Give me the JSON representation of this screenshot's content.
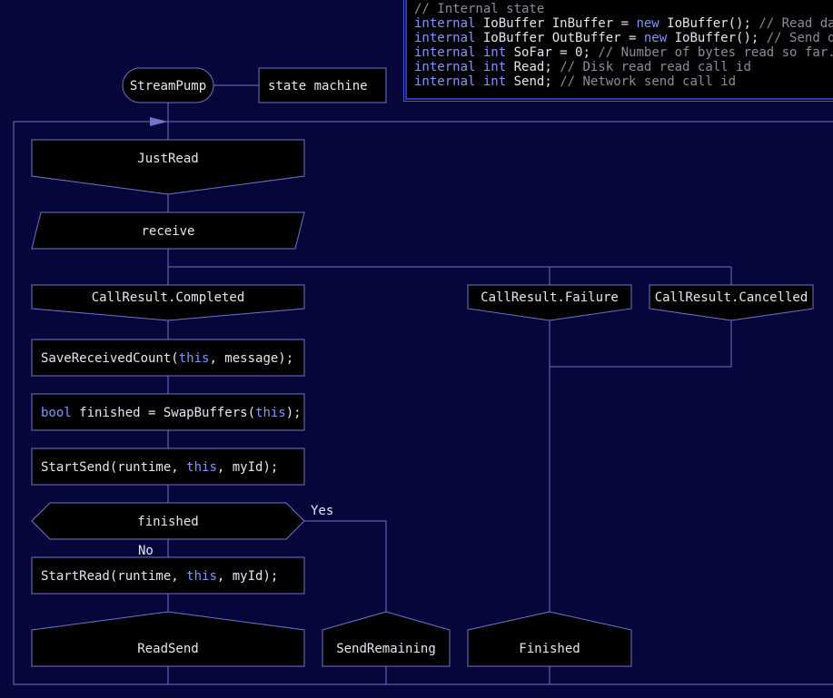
{
  "colors": {
    "background": "#06063a",
    "line": "#6f74c6",
    "box_fill": "#000000",
    "text": "#e6e6f0",
    "keyword": "#7f95ff",
    "comment": "#8c8c9c",
    "panel_border": "#2d38ba"
  },
  "code_panel": {
    "lines": [
      [
        {
          "t": "// Internal state",
          "c": "cm"
        }
      ],
      [
        {
          "t": "internal",
          "c": "kw"
        },
        {
          "t": " IoBuffer InBuffer = "
        },
        {
          "t": "new",
          "c": "kw"
        },
        {
          "t": " IoBuffer(); "
        },
        {
          "t": "// Read data",
          "c": "cm"
        }
      ],
      [
        {
          "t": "internal",
          "c": "kw"
        },
        {
          "t": " IoBuffer OutBuffer = "
        },
        {
          "t": "new",
          "c": "kw"
        },
        {
          "t": " IoBuffer(); "
        },
        {
          "t": "// Send data",
          "c": "cm"
        }
      ],
      [
        {
          "t": "internal",
          "c": "kw"
        },
        {
          "t": " "
        },
        {
          "t": "int",
          "c": "kw"
        },
        {
          "t": " SoFar = 0; "
        },
        {
          "t": "// Number of bytes read so far.",
          "c": "cm"
        }
      ],
      [
        {
          "t": "internal",
          "c": "kw"
        },
        {
          "t": " "
        },
        {
          "t": "int",
          "c": "kw"
        },
        {
          "t": " Read; "
        },
        {
          "t": "// Disk read read call id",
          "c": "cm"
        }
      ],
      [
        {
          "t": "internal",
          "c": "kw"
        },
        {
          "t": " "
        },
        {
          "t": "int",
          "c": "kw"
        },
        {
          "t": " Send; "
        },
        {
          "t": "// Network send call id",
          "c": "cm"
        }
      ]
    ]
  },
  "title": {
    "name": "StreamPump",
    "description": "state machine"
  },
  "nodes": {
    "just_read": "JustRead",
    "receive": "receive",
    "case_completed": "CallResult.Completed",
    "case_failure": "CallResult.Failure",
    "case_cancelled": "CallResult.Cancelled",
    "save_count": [
      {
        "t": "SaveReceivedCount("
      },
      {
        "t": "this",
        "c": "kw"
      },
      {
        "t": ", message);"
      }
    ],
    "swap_buffers": [
      {
        "t": "bool",
        "c": "kw"
      },
      {
        "t": " finished = SwapBuffers("
      },
      {
        "t": "this",
        "c": "kw"
      },
      {
        "t": ");"
      }
    ],
    "start_send": [
      {
        "t": "StartSend(runtime, "
      },
      {
        "t": "this",
        "c": "kw"
      },
      {
        "t": ", myId);"
      }
    ],
    "finished_question": "finished",
    "yes_label": "Yes",
    "no_label": "No",
    "start_read": [
      {
        "t": "StartRead(runtime, "
      },
      {
        "t": "this",
        "c": "kw"
      },
      {
        "t": ", myId);"
      }
    ],
    "read_send": "ReadSend",
    "send_remaining": "SendRemaining",
    "finished_end": "Finished"
  }
}
